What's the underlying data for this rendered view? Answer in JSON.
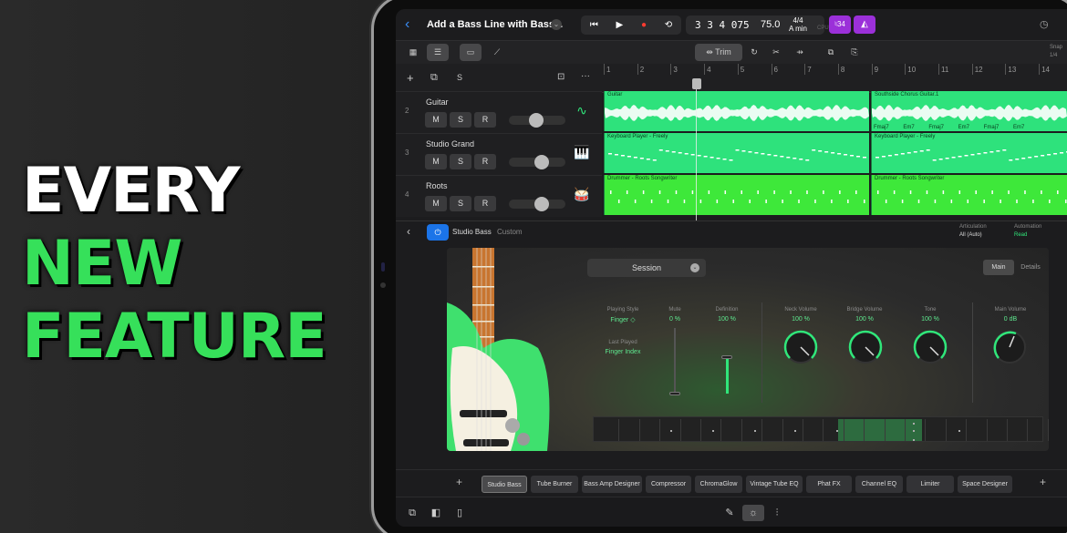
{
  "headline": {
    "line1": "EVERY",
    "line2": "NEW",
    "line3": "FEATURE"
  },
  "topbar": {
    "back": "‹",
    "title": "Add a Bass Line with Bass...",
    "lcd_position": "3 3 4 075",
    "tempo": "75.0",
    "time_sig": "4/4",
    "key": "A min",
    "cpu": "CPU",
    "tuner": "♮34"
  },
  "toolbar": {
    "trim_label": "Trim",
    "snap": "Snap",
    "snap_value": "1/4"
  },
  "track_header": {
    "add": "+",
    "solo": "S",
    "more": "···"
  },
  "ruler": {
    "bars": [
      "1",
      "2",
      "3",
      "4",
      "5",
      "6",
      "7",
      "8",
      "9",
      "10",
      "11",
      "12",
      "13",
      "14"
    ]
  },
  "tracks": [
    {
      "number": "2",
      "name": "Guitar",
      "mute": "M",
      "solo": "S",
      "rec": "R",
      "icon": "waveform-icon"
    },
    {
      "number": "3",
      "name": "Studio Grand",
      "mute": "M",
      "solo": "S",
      "rec": "R",
      "icon": "piano-icon"
    },
    {
      "number": "4",
      "name": "Roots",
      "mute": "M",
      "solo": "S",
      "rec": "R",
      "icon": "drums-icon"
    }
  ],
  "regions": {
    "guitar_a": "Guitar",
    "guitar_b": "Southside Chorus Guitar.1",
    "guitar_b_chords": "Fmaj7 Em7 Fmaj7 Em7 Fmaj7 Em7",
    "keys_a": "Keyboard Player - Freely",
    "keys_b": "Keyboard Player - Freely",
    "drums_a": "Drummer - Roots Songwriter",
    "drums_b": "Drummer - Roots Songwriter"
  },
  "plugin_header": {
    "name": "Studio Bass",
    "preset": "Custom",
    "articulation_label": "Articulation",
    "articulation_value": "All (Auto)",
    "automation_label": "Automation",
    "automation_value": "Read"
  },
  "instrument": {
    "session": "Session",
    "main_tab": "Main",
    "details_tab": "Details",
    "playing_style_label": "Playing Style",
    "playing_style_value": "Finger ◇",
    "last_played_label": "Last Played",
    "last_played_value": "Finger Index",
    "mute_label": "Mute",
    "mute_value": "0 %",
    "mute_level": 0,
    "definition_label": "Definition",
    "definition_value": "100 %",
    "definition_level": 1.0,
    "neck_label": "Neck Volume",
    "neck_value": "100 %",
    "bridge_label": "Bridge Volume",
    "bridge_value": "100 %",
    "tone_label": "Tone",
    "tone_value": "100 %",
    "main_label": "Main Volume",
    "main_value": "0 dB"
  },
  "plugins": [
    "Studio Bass",
    "Tube Burner",
    "Bass Amp Designer",
    "Compressor",
    "ChromaGlow",
    "Vintage Tube EQ",
    "Phat FX",
    "Channel EQ",
    "Limiter",
    "Space Designer"
  ],
  "colors": {
    "accent_green": "#30e67a",
    "region_green": "#2ee27c",
    "power_blue": "#1b74e8",
    "purple": "#9b30d9",
    "record_red": "#ff3b30"
  }
}
